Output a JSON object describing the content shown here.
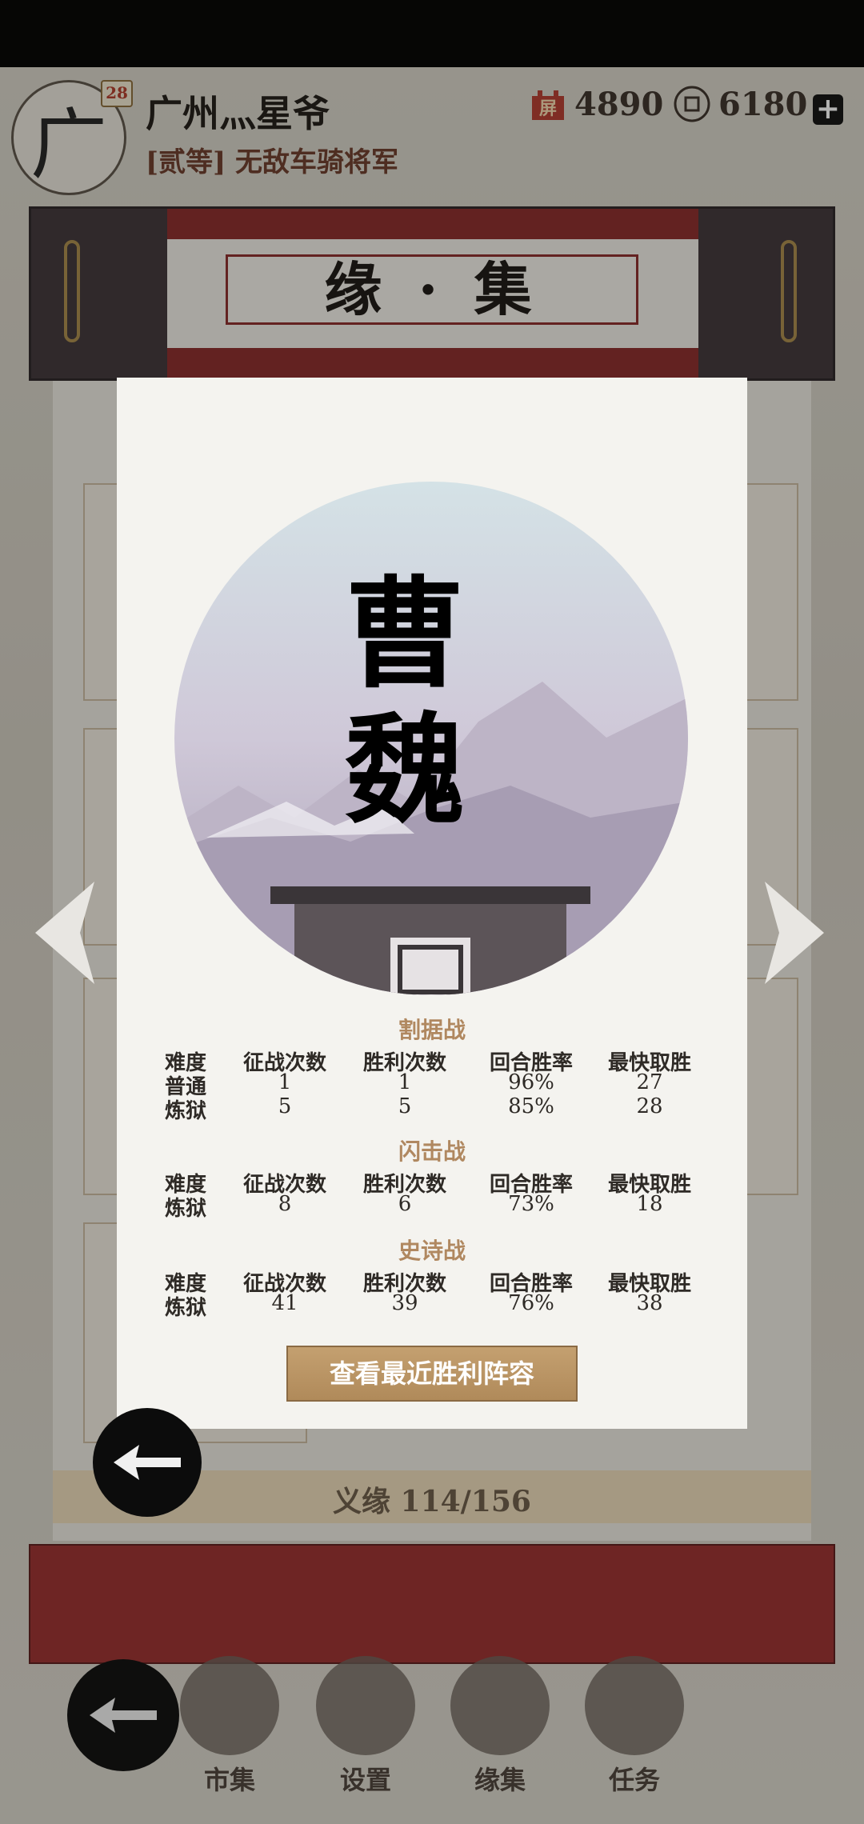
{
  "header": {
    "avatar_char": "广",
    "level": "28",
    "player_name": "广州灬星爷",
    "player_title": "[贰等] 无敌车骑将军",
    "resource1_icon": "屏",
    "resource1_value": "4890",
    "resource2_value": "6180",
    "plus_label": "+"
  },
  "banner": {
    "title": "缘 · 集"
  },
  "footer": {
    "text": "义缘  114/156"
  },
  "nav": [
    {
      "label": "市集"
    },
    {
      "label": "设置"
    },
    {
      "label": "缘集"
    },
    {
      "label": "任务"
    }
  ],
  "dialog": {
    "faction_name_top": "曹",
    "faction_name_bottom": "魏",
    "headers": [
      "难度",
      "征战次数",
      "胜利次数",
      "回合胜率",
      "最快取胜"
    ],
    "sections": [
      {
        "title": "割据战",
        "rows": [
          [
            "普通",
            "1",
            "1",
            "96%",
            "27"
          ],
          [
            "炼狱",
            "5",
            "5",
            "85%",
            "28"
          ]
        ]
      },
      {
        "title": "闪击战",
        "rows": [
          [
            "炼狱",
            "8",
            "6",
            "73%",
            "18"
          ]
        ]
      },
      {
        "title": "史诗战",
        "rows": [
          [
            "炼狱",
            "41",
            "39",
            "76%",
            "38"
          ]
        ]
      }
    ],
    "view_button": "查看最近胜利阵容"
  },
  "colors": {
    "accent": "#b08860",
    "banner_red": "#8a2a2a",
    "button": "#b08a5a"
  }
}
